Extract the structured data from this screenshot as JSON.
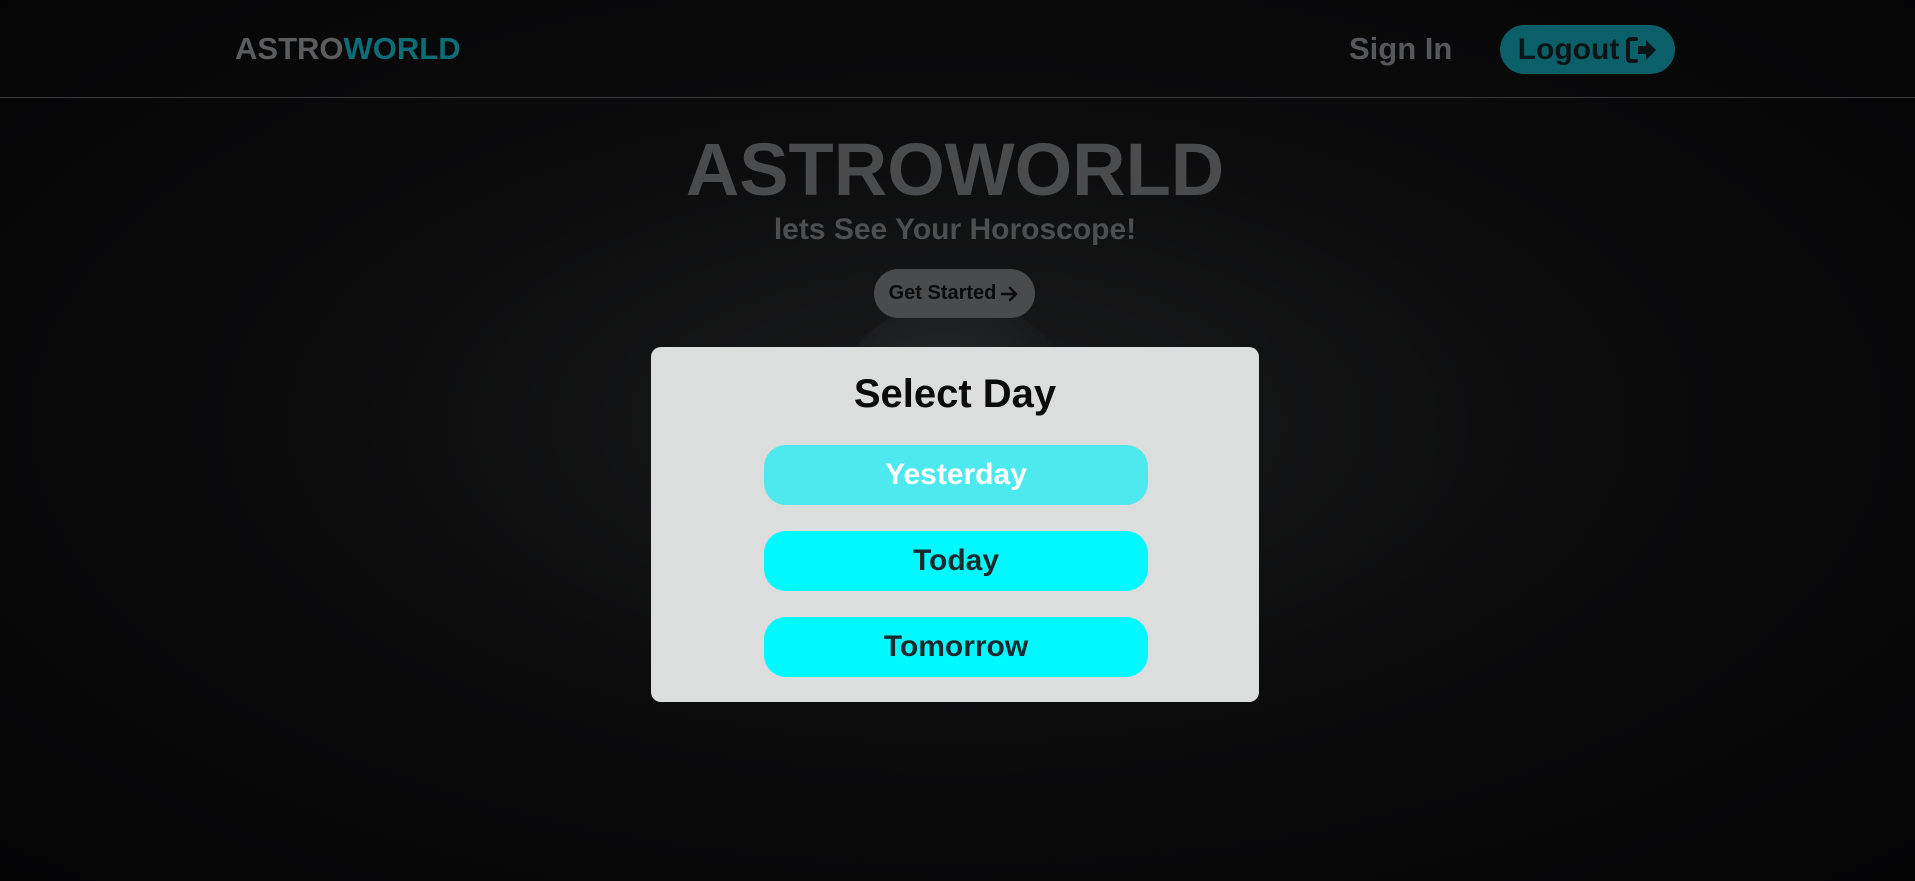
{
  "header": {
    "logo_part1": "ASTRO",
    "logo_part2": "WORLD",
    "signin_label": "Sign In",
    "logout_label": "Logout"
  },
  "hero": {
    "title": "ASTROWORLD",
    "subtitle": "lets See Your Horoscope!",
    "cta_label": "Get Started"
  },
  "modal": {
    "title": "Select Day",
    "options": [
      "Yesterday",
      "Today",
      "Tomorrow"
    ],
    "hovered_option": "Yesterday"
  },
  "colors": {
    "accent": "#00f8ff",
    "accent_hover": "#4de9ef",
    "logo_accent": "#0c6d77",
    "modal_bg": "#dcdddd"
  },
  "icons": {
    "logout": "sign-out-icon",
    "cta": "arrow-right-icon"
  }
}
